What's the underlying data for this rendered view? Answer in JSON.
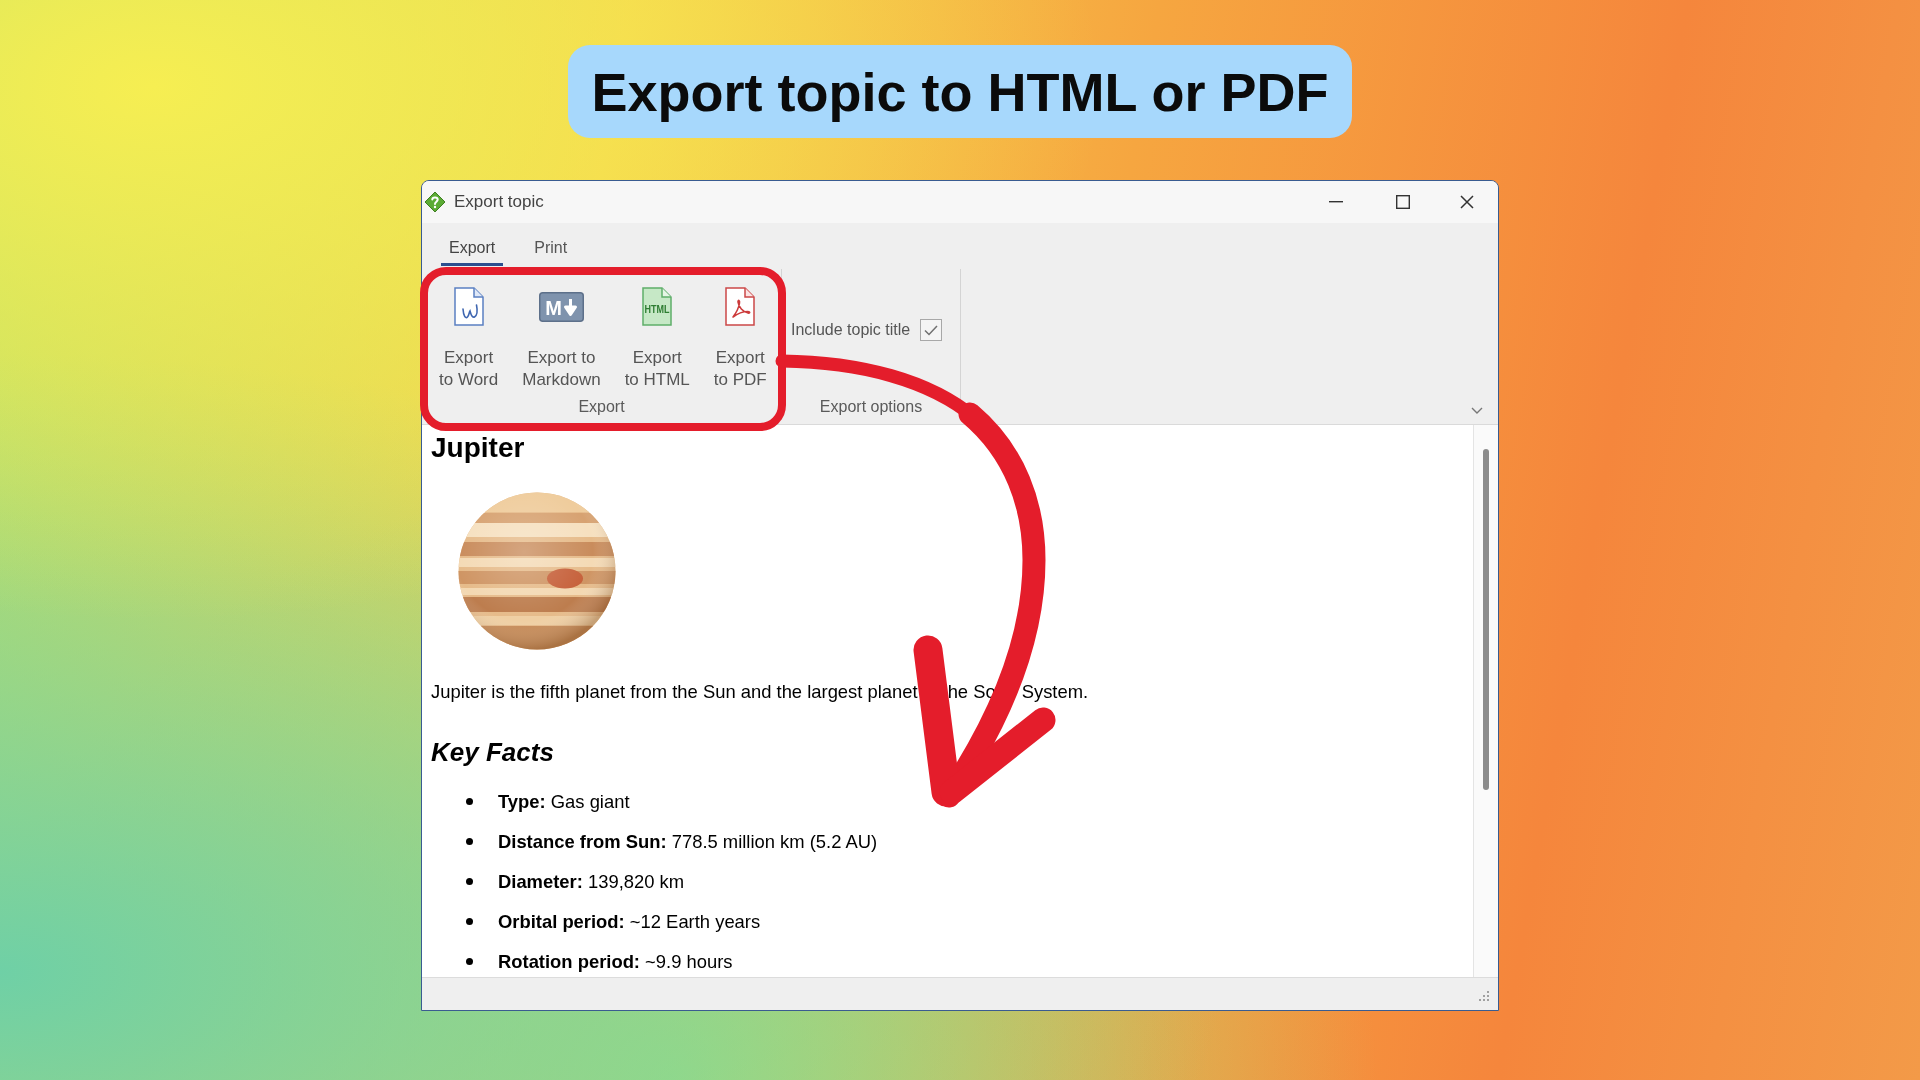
{
  "banner": {
    "title": "Export topic to HTML or PDF"
  },
  "window": {
    "title": "Export topic"
  },
  "tabs": [
    {
      "label": "Export",
      "selected": true
    },
    {
      "label": "Print",
      "selected": false
    }
  ],
  "export_group": {
    "label": "Export",
    "buttons": [
      {
        "kind": "word",
        "lines": [
          "Export",
          "to Word"
        ]
      },
      {
        "kind": "markdown",
        "icon_text": "M",
        "lines": [
          "Export to",
          "Markdown"
        ]
      },
      {
        "kind": "html",
        "icon_text": "HTML",
        "lines": [
          "Export",
          "to HTML"
        ]
      },
      {
        "kind": "pdf",
        "lines": [
          "Export",
          "to PDF"
        ]
      }
    ]
  },
  "options_group": {
    "label": "Export options",
    "include_topic_title": {
      "label": "Include topic title",
      "checked": true
    }
  },
  "document": {
    "heading": "Jupiter",
    "intro_visible_parts": [
      "Jupiter is the fifth planet from the Sun and the largest planet",
      "he So",
      "System."
    ],
    "section_heading": "Key Facts",
    "facts": [
      "**Type:** Gas giant",
      "**Distance from Sun:** 778.5 million km (5.2 AU)",
      "**Diameter:** 139,820 km",
      "**Orbital period:** ~12 Earth years",
      "**Rotation period:** ~9.9 hours"
    ]
  }
}
